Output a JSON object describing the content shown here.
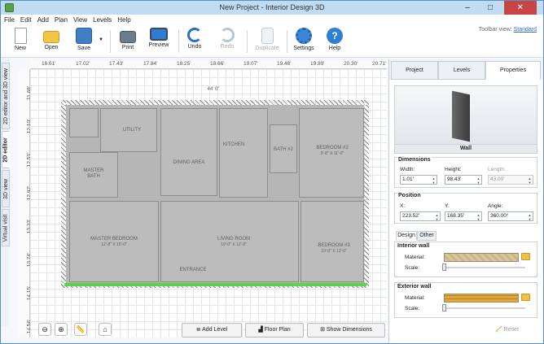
{
  "window": {
    "title": "New Project - Interior Design 3D",
    "buttons": {
      "minimize": "–",
      "maximize": "□",
      "close": "✕"
    }
  },
  "menu": [
    "File",
    "Edit",
    "Add",
    "Plan",
    "View",
    "Levels",
    "Help"
  ],
  "toolbar_view": {
    "label": "Toolbar view:",
    "value": "Standard"
  },
  "toolbar": [
    {
      "label": "New",
      "icon": "new-file-icon"
    },
    {
      "label": "Open",
      "icon": "folder-open-icon"
    },
    {
      "label": "Save",
      "icon": "save-icon"
    },
    {
      "label": "Print",
      "icon": "printer-icon"
    },
    {
      "label": "Preview",
      "icon": "monitor-icon"
    },
    {
      "label": "Undo",
      "icon": "undo-icon"
    },
    {
      "label": "Redo",
      "icon": "redo-icon"
    },
    {
      "label": "Duplicate",
      "icon": "duplicate-icon"
    },
    {
      "label": "Settings",
      "icon": "gear-icon"
    },
    {
      "label": "Help",
      "icon": "help-icon"
    }
  ],
  "side_tabs": [
    "2D editor and 3D view",
    "2D editor",
    "3D view",
    "Virtual visit"
  ],
  "active_side_tab": "2D editor",
  "ruler_h": [
    "16.61'",
    "17.02'",
    "17.43'",
    "17.84'",
    "18.25'",
    "18.66'",
    "19.07'",
    "19.48'",
    "19.89'",
    "20.30'",
    "20.71'"
  ],
  "ruler_v": [
    "11.69'",
    "12.10'",
    "12.51'",
    "12.92'",
    "13.33'",
    "13.74'",
    "14.15'",
    "14.56'"
  ],
  "plan": {
    "dimension_top": "44' 0\"",
    "rooms": [
      {
        "name": "UTILITY",
        "sub": ""
      },
      {
        "name": "KITCHEN",
        "sub": ""
      },
      {
        "name": "DINING AREA",
        "sub": ""
      },
      {
        "name": "MASTER BATH",
        "sub": ""
      },
      {
        "name": "BATH #2",
        "sub": ""
      },
      {
        "name": "BEDROOM #2",
        "sub": "9'-8\" X 11'-0\""
      },
      {
        "name": "MASTER BEDROOM",
        "sub": "12'-8\" X 15'-0\""
      },
      {
        "name": "LIVING ROOM",
        "sub": "19'-0\" X 12'-8\""
      },
      {
        "name": "BEDROOM #3",
        "sub": "10'-0\" X 12'-0\""
      },
      {
        "name": "ENTRANCE",
        "sub": ""
      }
    ]
  },
  "canvas_tools": [
    "zoom-out-icon",
    "zoom-in-icon",
    "ruler-icon",
    "home-icon"
  ],
  "bottom_buttons": [
    "Add Level",
    "Floor Plan",
    "Show Dimensions"
  ],
  "right_panel": {
    "tabs": [
      "Project",
      "Levels",
      "Properties"
    ],
    "active_tab": "Properties",
    "preview_caption": "Wall",
    "dimensions": {
      "title": "Dimensions",
      "width_label": "Width:",
      "width": "1.01'",
      "height_label": "Height:",
      "height": "98.43'",
      "length_label": "Length:",
      "length": "43.00'"
    },
    "position": {
      "title": "Position",
      "x_label": "X:",
      "x": "223.52'",
      "y_label": "Y:",
      "y": "168.35'",
      "angle_label": "Angle:",
      "angle": "360.00°"
    },
    "material_tabs": [
      "Design",
      "Other"
    ],
    "interior_wall": {
      "title": "Interior wall",
      "material_label": "Material:",
      "scale_label": "Scale:"
    },
    "exterior_wall": {
      "title": "Exterior wall",
      "material_label": "Material:",
      "scale_label": "Scale:"
    },
    "reset_label": "Reset"
  },
  "colors": {
    "titlebar": "#bfdcf3",
    "selection": "#5bd34f",
    "close": "#c74545",
    "accent": "#3366cc"
  }
}
